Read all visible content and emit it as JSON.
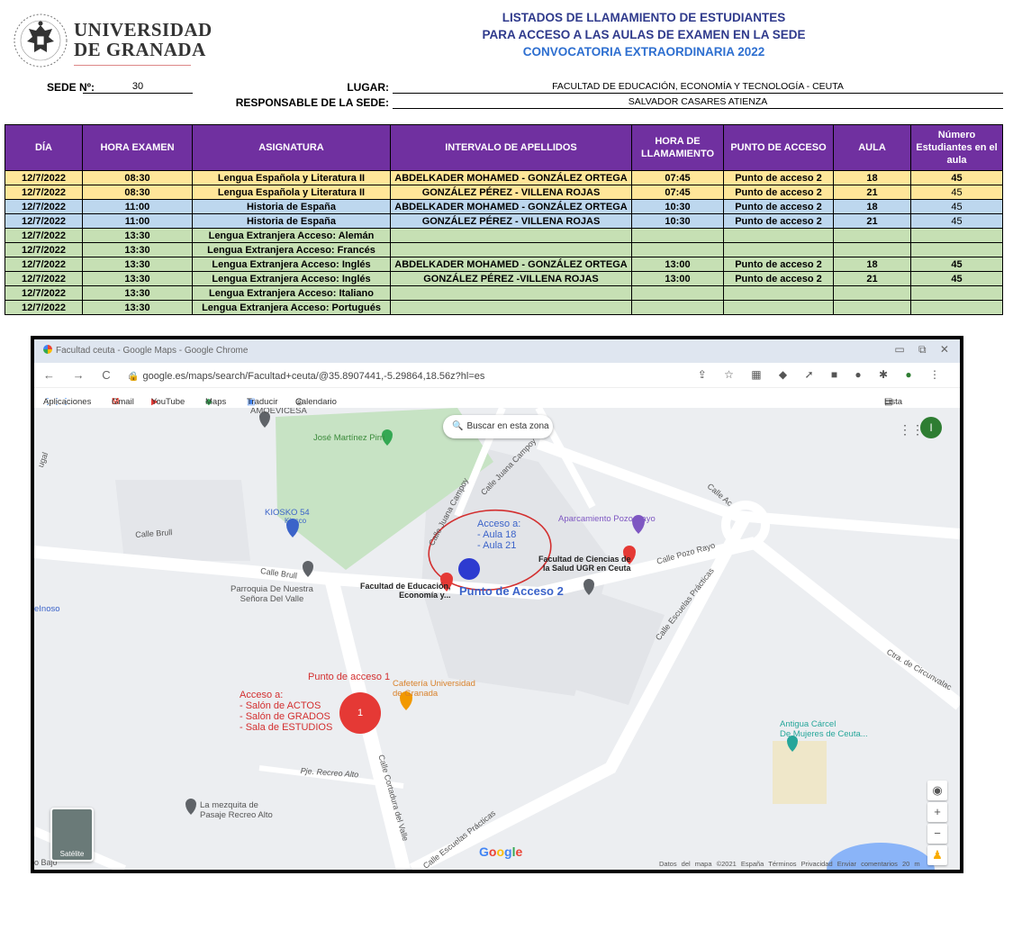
{
  "header": {
    "logo_line1": "UNIVERSIDAD",
    "logo_line2": "DE GRANADA",
    "title_line1": "LISTADOS DE LLAMAMIENTO DE ESTUDIANTES",
    "title_line2": "PARA ACCESO A LAS AULAS DE EXAMEN EN LA SEDE",
    "title_line3": "CONVOCATORIA EXTRAORDINARIA 2022",
    "sede_label": "SEDE Nº:",
    "sede_value": "30",
    "lugar_label": "LUGAR:",
    "lugar_value": "FACULTAD DE EDUCACIÓN, ECONOMÍA Y TECNOLOGÍA - CEUTA",
    "responsable_label": "RESPONSABLE DE LA SEDE:",
    "responsable_value": "SALVADOR CASARES ATIENZA"
  },
  "table": {
    "headers": [
      "DÍA",
      "HORA EXAMEN",
      "ASIGNATURA",
      "INTERVALO DE APELLIDOS",
      "HORA DE LLAMAMIENTO",
      "PUNTO DE ACCESO",
      "AULA",
      "Número Estudiantes en el aula"
    ],
    "rows": [
      {
        "group": "lengua",
        "cells": [
          "12/7/2022",
          "08:30",
          "Lengua Española y Literatura II",
          "ABDELKADER MOHAMED - GONZÁLEZ ORTEGA",
          "07:45",
          "Punto de acceso 2",
          "18",
          "45"
        ]
      },
      {
        "group": "lengua",
        "cells": [
          "12/7/2022",
          "08:30",
          "Lengua Española y Literatura II",
          "GONZÁLEZ PÉREZ - VILLENA ROJAS",
          "07:45",
          "Punto de acceso 2",
          "21",
          "45"
        ]
      },
      {
        "group": "historia",
        "cells": [
          "12/7/2022",
          "11:00",
          "Historia de España",
          "ABDELKADER MOHAMED - GONZÁLEZ ORTEGA",
          "10:30",
          "Punto de acceso 2",
          "18",
          "45"
        ]
      },
      {
        "group": "historia",
        "cells": [
          "12/7/2022",
          "11:00",
          "Historia de España",
          "GONZÁLEZ PÉREZ - VILLENA ROJAS",
          "10:30",
          "Punto de acceso 2",
          "21",
          "45"
        ]
      },
      {
        "group": "extranjera",
        "cells": [
          "12/7/2022",
          "13:30",
          "Lengua Extranjera Acceso: Alemán",
          "",
          "",
          "",
          "",
          ""
        ]
      },
      {
        "group": "extranjera",
        "cells": [
          "12/7/2022",
          "13:30",
          "Lengua Extranjera Acceso: Francés",
          "",
          "",
          "",
          "",
          ""
        ]
      },
      {
        "group": "extranjera",
        "cells": [
          "12/7/2022",
          "13:30",
          "Lengua Extranjera Acceso:  Inglés",
          "ABDELKADER MOHAMED - GONZÁLEZ ORTEGA",
          "13:00",
          "Punto de acceso 2",
          "18",
          "45"
        ]
      },
      {
        "group": "extranjera",
        "cells": [
          "12/7/2022",
          "13:30",
          "Lengua Extranjera Acceso:  Inglés",
          "GONZÁLEZ PÉREZ -VILLENA ROJAS",
          "13:00",
          "Punto de acceso 2",
          "21",
          "45"
        ]
      },
      {
        "group": "extranjera",
        "cells": [
          "12/7/2022",
          "13:30",
          "Lengua Extranjera Acceso: Italiano",
          "",
          "",
          "",
          "",
          ""
        ]
      },
      {
        "group": "extranjera",
        "cells": [
          "12/7/2022",
          "13:30",
          "Lengua Extranjera Acceso:  Portugués",
          "",
          "",
          "",
          "",
          ""
        ]
      }
    ]
  },
  "browser": {
    "tab_title": "Facultad ceuta - Google Maps - Google Chrome",
    "url": "google.es/maps/search/Facultad+ceuta/@35.8907441,-5.29864,18.56z?hl=es",
    "bookmarks": [
      "Aplicaciones",
      "Gmail",
      "YouTube",
      "Maps",
      "Traducir",
      "Calendario de activi..."
    ],
    "reading_list": "Lista de lectura",
    "avatar_letter": "I"
  },
  "map": {
    "search_here": "Buscar en esta zona",
    "labels": {
      "amc": "AMOEVICESA",
      "park": "José Martínez Pirri",
      "kiosko": "KIOSKO 54",
      "kiosko_sub": "Kiosco",
      "parroquia": "Parroquia De Nuestra\nSeñora Del Valle",
      "fac_edu": "Facultad de Educación,\nEconomía y...",
      "fac_ciencias": "Facultad de Ciencias de\nla Salud UGR en Ceuta",
      "aparcamiento": "Aparcamiento Pozo Rayo",
      "cafeteria": "Cafetería Universidad\nde Granada",
      "carcel": "Antigua Cárcel\nDe Mujeres de Ceuta...",
      "mezquita": "La mezquita de\nPasaje Recreo Alto",
      "moreno": "eInoso",
      "satellite": "Satélite"
    },
    "streets": {
      "brull": "Calle Brull",
      "brull2": "Calle Brull",
      "juana1": "Calle Juana Campoy",
      "juana2": "Calle Juana Campoy",
      "pozo": "Calle Pozo Rayo",
      "ac": "Calle Ac",
      "escuelas1": "Calle Escuelas Prácticas",
      "escuelas2": "Calle Escuelas Prácticas",
      "cortadura": "Calle Cortadura del Valle",
      "recreo": "Pje. Recreo Alto",
      "circunvalacion": "Ctra. de Circunvalac",
      "bajo": "o Bajo",
      "ugal": "ugal"
    },
    "annotation_blue": "Acceso a:\n- Aula 18\n- Aula 21",
    "punto_acceso_2": "Punto de Acceso 2",
    "punto_acceso_1": "Punto de acceso 1",
    "annotation_red": "Acceso a:\n- Salón de ACTOS\n- Salón de GRADOS\n- Sala de ESTUDIOS",
    "marker_1": "1",
    "google": "Google",
    "footer": "Datos del mapa ©2021   España   Términos   Privacidad   Enviar comentarios   20 m"
  }
}
